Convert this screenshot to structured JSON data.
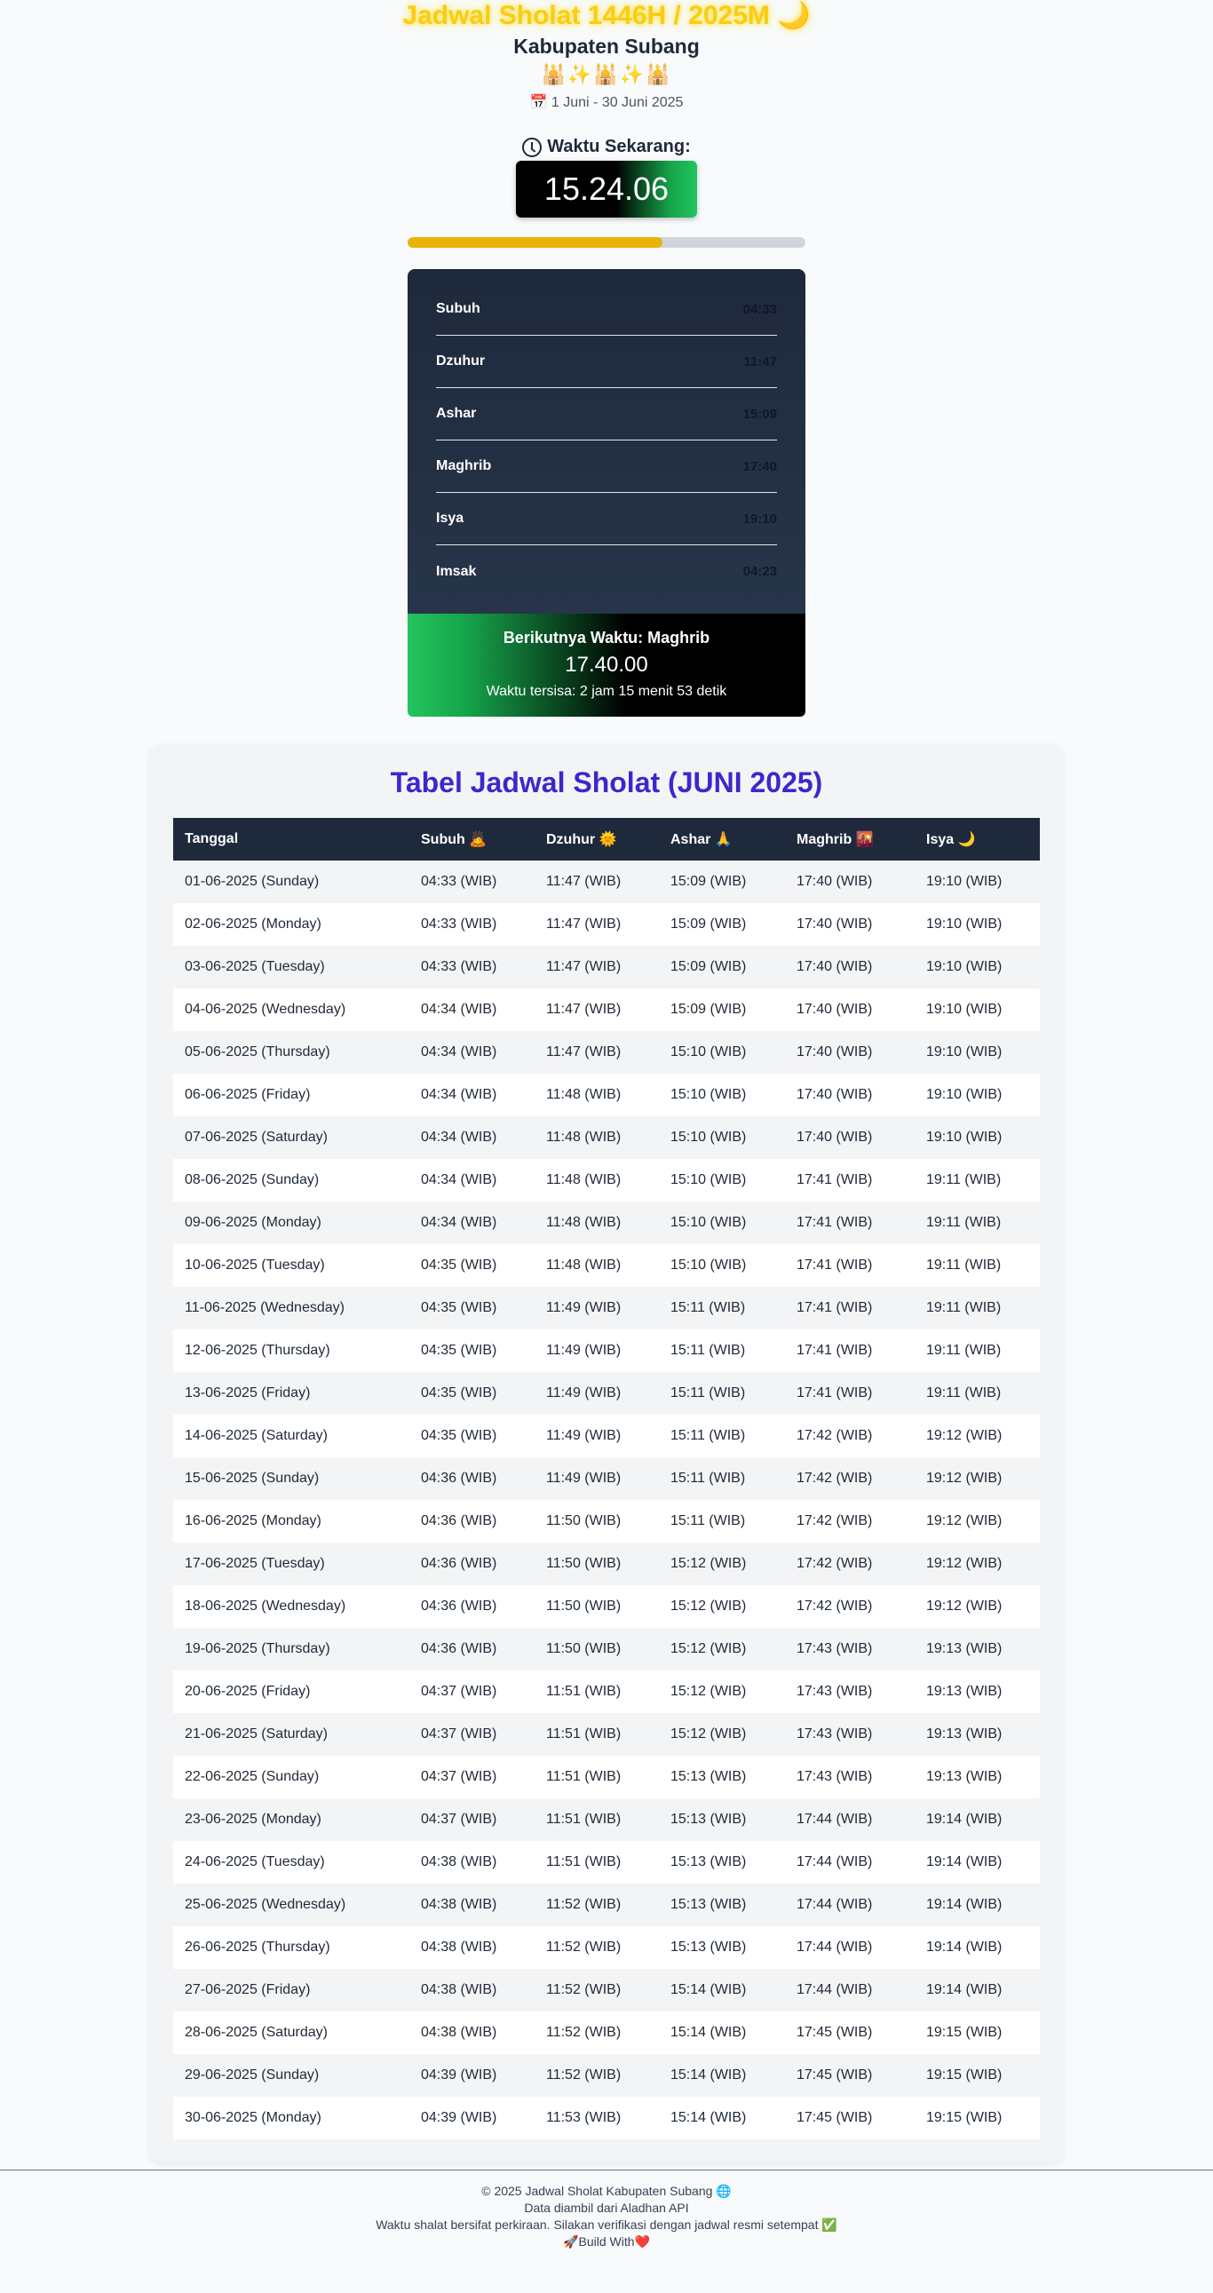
{
  "header": {
    "title": "Jadwal Sholat 1446H / 2025M 🌙",
    "region": "Kabupaten Subang",
    "decoration": "🕌✨🕌✨🕌",
    "date_range": "📅 1 Juni - 30 Juni 2025"
  },
  "current": {
    "label": "Waktu Sekarang:",
    "time": "15.24.06",
    "day_progress": 0.64
  },
  "prayer_times": [
    {
      "name": "Subuh",
      "time": "04:33"
    },
    {
      "name": "Dzuhur",
      "time": "11:47"
    },
    {
      "name": "Ashar",
      "time": "15:09"
    },
    {
      "name": "Maghrib",
      "time": "17:40"
    },
    {
      "name": "Isya",
      "time": "19:10"
    },
    {
      "name": "Imsak",
      "time": "04:23"
    }
  ],
  "next": {
    "label": "Berikutnya Waktu: Maghrib",
    "time": "17.40.00",
    "remaining": "Waktu tersisa: 2 jam 15 menit 53 detik"
  },
  "table": {
    "title": "Tabel Jadwal Sholat (JUNI 2025)",
    "headers": [
      "Tanggal",
      "Subuh 🙇",
      "Dzuhur 🌞",
      "Ashar 🙏",
      "Maghrib 🌇",
      "Isya 🌙"
    ],
    "rows": [
      [
        "01-06-2025 (Sunday)",
        "04:33 (WIB)",
        "11:47 (WIB)",
        "15:09 (WIB)",
        "17:40 (WIB)",
        "19:10 (WIB)"
      ],
      [
        "02-06-2025 (Monday)",
        "04:33 (WIB)",
        "11:47 (WIB)",
        "15:09 (WIB)",
        "17:40 (WIB)",
        "19:10 (WIB)"
      ],
      [
        "03-06-2025 (Tuesday)",
        "04:33 (WIB)",
        "11:47 (WIB)",
        "15:09 (WIB)",
        "17:40 (WIB)",
        "19:10 (WIB)"
      ],
      [
        "04-06-2025 (Wednesday)",
        "04:34 (WIB)",
        "11:47 (WIB)",
        "15:09 (WIB)",
        "17:40 (WIB)",
        "19:10 (WIB)"
      ],
      [
        "05-06-2025 (Thursday)",
        "04:34 (WIB)",
        "11:47 (WIB)",
        "15:10 (WIB)",
        "17:40 (WIB)",
        "19:10 (WIB)"
      ],
      [
        "06-06-2025 (Friday)",
        "04:34 (WIB)",
        "11:48 (WIB)",
        "15:10 (WIB)",
        "17:40 (WIB)",
        "19:10 (WIB)"
      ],
      [
        "07-06-2025 (Saturday)",
        "04:34 (WIB)",
        "11:48 (WIB)",
        "15:10 (WIB)",
        "17:40 (WIB)",
        "19:10 (WIB)"
      ],
      [
        "08-06-2025 (Sunday)",
        "04:34 (WIB)",
        "11:48 (WIB)",
        "15:10 (WIB)",
        "17:41 (WIB)",
        "19:11 (WIB)"
      ],
      [
        "09-06-2025 (Monday)",
        "04:34 (WIB)",
        "11:48 (WIB)",
        "15:10 (WIB)",
        "17:41 (WIB)",
        "19:11 (WIB)"
      ],
      [
        "10-06-2025 (Tuesday)",
        "04:35 (WIB)",
        "11:48 (WIB)",
        "15:10 (WIB)",
        "17:41 (WIB)",
        "19:11 (WIB)"
      ],
      [
        "11-06-2025 (Wednesday)",
        "04:35 (WIB)",
        "11:49 (WIB)",
        "15:11 (WIB)",
        "17:41 (WIB)",
        "19:11 (WIB)"
      ],
      [
        "12-06-2025 (Thursday)",
        "04:35 (WIB)",
        "11:49 (WIB)",
        "15:11 (WIB)",
        "17:41 (WIB)",
        "19:11 (WIB)"
      ],
      [
        "13-06-2025 (Friday)",
        "04:35 (WIB)",
        "11:49 (WIB)",
        "15:11 (WIB)",
        "17:41 (WIB)",
        "19:11 (WIB)"
      ],
      [
        "14-06-2025 (Saturday)",
        "04:35 (WIB)",
        "11:49 (WIB)",
        "15:11 (WIB)",
        "17:42 (WIB)",
        "19:12 (WIB)"
      ],
      [
        "15-06-2025 (Sunday)",
        "04:36 (WIB)",
        "11:49 (WIB)",
        "15:11 (WIB)",
        "17:42 (WIB)",
        "19:12 (WIB)"
      ],
      [
        "16-06-2025 (Monday)",
        "04:36 (WIB)",
        "11:50 (WIB)",
        "15:11 (WIB)",
        "17:42 (WIB)",
        "19:12 (WIB)"
      ],
      [
        "17-06-2025 (Tuesday)",
        "04:36 (WIB)",
        "11:50 (WIB)",
        "15:12 (WIB)",
        "17:42 (WIB)",
        "19:12 (WIB)"
      ],
      [
        "18-06-2025 (Wednesday)",
        "04:36 (WIB)",
        "11:50 (WIB)",
        "15:12 (WIB)",
        "17:42 (WIB)",
        "19:12 (WIB)"
      ],
      [
        "19-06-2025 (Thursday)",
        "04:36 (WIB)",
        "11:50 (WIB)",
        "15:12 (WIB)",
        "17:43 (WIB)",
        "19:13 (WIB)"
      ],
      [
        "20-06-2025 (Friday)",
        "04:37 (WIB)",
        "11:51 (WIB)",
        "15:12 (WIB)",
        "17:43 (WIB)",
        "19:13 (WIB)"
      ],
      [
        "21-06-2025 (Saturday)",
        "04:37 (WIB)",
        "11:51 (WIB)",
        "15:12 (WIB)",
        "17:43 (WIB)",
        "19:13 (WIB)"
      ],
      [
        "22-06-2025 (Sunday)",
        "04:37 (WIB)",
        "11:51 (WIB)",
        "15:13 (WIB)",
        "17:43 (WIB)",
        "19:13 (WIB)"
      ],
      [
        "23-06-2025 (Monday)",
        "04:37 (WIB)",
        "11:51 (WIB)",
        "15:13 (WIB)",
        "17:44 (WIB)",
        "19:14 (WIB)"
      ],
      [
        "24-06-2025 (Tuesday)",
        "04:38 (WIB)",
        "11:51 (WIB)",
        "15:13 (WIB)",
        "17:44 (WIB)",
        "19:14 (WIB)"
      ],
      [
        "25-06-2025 (Wednesday)",
        "04:38 (WIB)",
        "11:52 (WIB)",
        "15:13 (WIB)",
        "17:44 (WIB)",
        "19:14 (WIB)"
      ],
      [
        "26-06-2025 (Thursday)",
        "04:38 (WIB)",
        "11:52 (WIB)",
        "15:13 (WIB)",
        "17:44 (WIB)",
        "19:14 (WIB)"
      ],
      [
        "27-06-2025 (Friday)",
        "04:38 (WIB)",
        "11:52 (WIB)",
        "15:14 (WIB)",
        "17:44 (WIB)",
        "19:14 (WIB)"
      ],
      [
        "28-06-2025 (Saturday)",
        "04:38 (WIB)",
        "11:52 (WIB)",
        "15:14 (WIB)",
        "17:45 (WIB)",
        "19:15 (WIB)"
      ],
      [
        "29-06-2025 (Sunday)",
        "04:39 (WIB)",
        "11:52 (WIB)",
        "15:14 (WIB)",
        "17:45 (WIB)",
        "19:15 (WIB)"
      ],
      [
        "30-06-2025 (Monday)",
        "04:39 (WIB)",
        "11:53 (WIB)",
        "15:14 (WIB)",
        "17:45 (WIB)",
        "19:15 (WIB)"
      ]
    ]
  },
  "footer": {
    "lines": [
      "© 2025 Jadwal Sholat Kabupaten Subang 🌐",
      "Data diambil dari Aladhan API",
      "Waktu shalat bersifat perkiraan. Silakan verifikasi dengan jadwal resmi setempat ✅",
      "🚀Build With❤️"
    ]
  },
  "colors": {
    "title": "#facc15",
    "table_title": "#3b28cc",
    "progress": "#eab308",
    "panel": "#1e293b"
  }
}
